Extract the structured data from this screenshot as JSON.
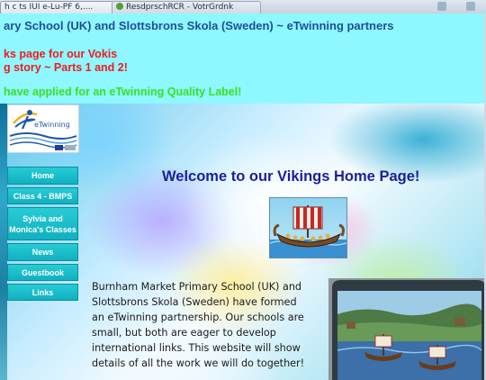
{
  "browser": {
    "tabs": [
      {
        "label": "h c ts IUI e-Lu-PF 6,...."
      },
      {
        "label": "ResdprschRCR - VotrGrdnk"
      }
    ]
  },
  "header": {
    "title": "ary School (UK) and Slottsbrons Skola (Sweden) ~ eTwinning partners",
    "announcement_line1": "ks page for our Vokis",
    "announcement_line2": "g story ~ Parts 1 and 2!",
    "quality_label_notice": "have applied for an eTwinning Quality Label!",
    "background_color": "#8ff7ff"
  },
  "logo": {
    "text": "eTwinning"
  },
  "nav": {
    "items": [
      {
        "label": "Home"
      },
      {
        "label": "Class 4 - BMPS"
      },
      {
        "label": "Sylvia and Monica's Classes"
      },
      {
        "label": "News"
      },
      {
        "label": "Guestbook"
      },
      {
        "label": "Links"
      }
    ],
    "color": "#1bbdcb"
  },
  "main": {
    "heading": "Welcome to our Vikings Home Page!",
    "intro_lines": [
      "Burnham Market Primary School (UK) and",
      "Slottsbrons Skola (Sweden) have formed",
      "an eTwinning partnership. Our schools are",
      "small, but both are eager to develop",
      "international links. This website will show",
      "details of all the work we will do together!"
    ]
  },
  "colors": {
    "heading": "#1b1f9c",
    "announcement": "#ee1c1c",
    "notice": "#37e21f",
    "title": "#1d4f9a"
  }
}
